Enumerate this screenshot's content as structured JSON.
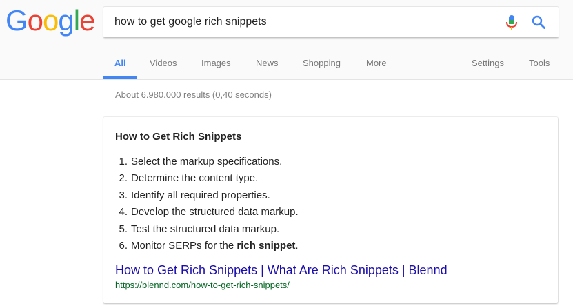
{
  "logo": {
    "text": "Google",
    "letters": [
      "G",
      "o",
      "o",
      "g",
      "l",
      "e"
    ],
    "colors": [
      "#4285F4",
      "#EA4335",
      "#FBBC05",
      "#4285F4",
      "#34A853",
      "#EA4335"
    ]
  },
  "search": {
    "value": "how to get google rich snippets"
  },
  "tabs": [
    {
      "label": "All",
      "active": true
    },
    {
      "label": "Videos"
    },
    {
      "label": "Images"
    },
    {
      "label": "News"
    },
    {
      "label": "Shopping"
    },
    {
      "label": "More"
    },
    {
      "label": "Settings"
    },
    {
      "label": "Tools"
    }
  ],
  "result_stats": "About 6.980.000 results (0,40 seconds)",
  "featured_snippet": {
    "title": "How to Get Rich Snippets",
    "steps": [
      {
        "num": "1.",
        "text": "Select the markup specifications."
      },
      {
        "num": "2.",
        "text": "Determine the content type."
      },
      {
        "num": "3.",
        "text": "Identify all required properties."
      },
      {
        "num": "4.",
        "text": "Develop the structured data markup."
      },
      {
        "num": "5.",
        "text": "Test the structured data markup."
      },
      {
        "num": "6.",
        "text": "Monitor SERPs for the ",
        "bold": "rich snippet",
        "suffix": "."
      }
    ],
    "link_title": "How to Get Rich Snippets | What Are Rich Snippets | Blennd",
    "url": "https://blennd.com/how-to-get-rich-snippets/"
  },
  "icons": {
    "mic": "microphone-icon",
    "search": "magnifier-icon"
  },
  "colors": {
    "accent": "#4285F4",
    "link": "#1A0DAB",
    "url": "#006621"
  }
}
